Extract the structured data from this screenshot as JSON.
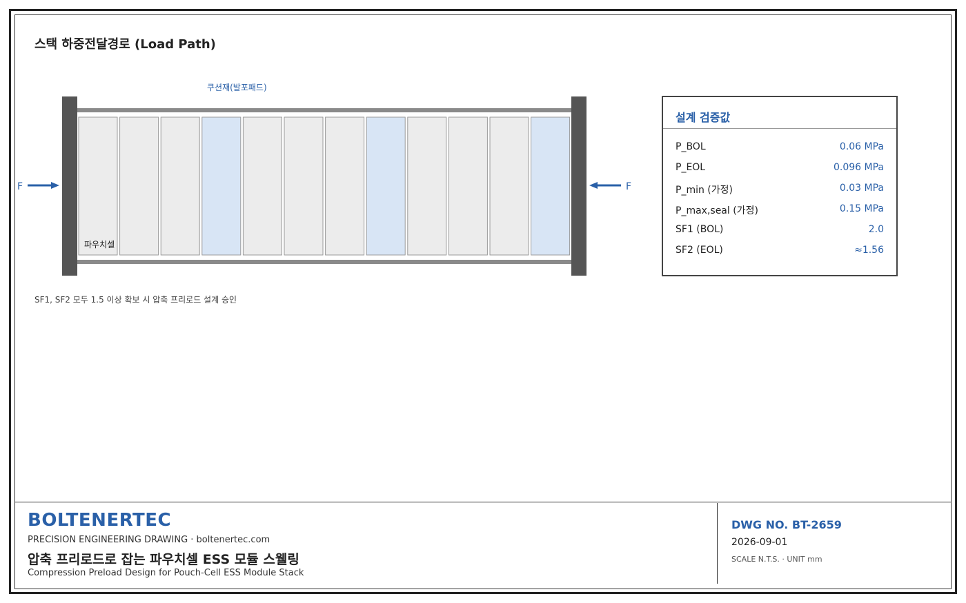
{
  "diagram": {
    "title": "스택 하중전달경로 (Load Path)",
    "top_label": "쿠션재(발포패드)",
    "cell_label": "파우치셀",
    "force_label_left": "F",
    "force_label_right": "F",
    "note": "SF1, SF2 모두 1.5 이상 확보 시 압축 프리로드 설계 승인",
    "cell_count": 12,
    "cushion_positions": [
      4,
      8,
      12
    ],
    "colors": {
      "cell_fill": "#ececec",
      "cushion_fill": "#d8e5f5",
      "end_plate": "#555555",
      "arrow": "#2a60a8"
    }
  },
  "spec": {
    "title": "설계 검증값",
    "rows": [
      {
        "key": "P_BOL",
        "value": "0.06 MPa"
      },
      {
        "key": "P_EOL",
        "value": "0.096 MPa"
      },
      {
        "key": "P_min (가정)",
        "value": "0.03 MPa"
      },
      {
        "key": "P_max,seal (가정)",
        "value": "0.15 MPa"
      },
      {
        "key": "SF1 (BOL)",
        "value": "2.0"
      },
      {
        "key": "SF2 (EOL)",
        "value": "≈1.56"
      }
    ]
  },
  "title_block": {
    "brand": "BOLTENERTEC",
    "subtitle": "PRECISION ENGINEERING DRAWING · boltenertec.com",
    "title_ko": "압축 프리로드로 잡는 파우치셀 ESS 모듈 스웰링",
    "title_en": "Compression Preload Design for Pouch-Cell ESS Module Stack",
    "dwg_no": "DWG NO. BT-2659",
    "date": "2026-09-01",
    "scale": "SCALE N.T.S.  ·  UNIT mm"
  }
}
